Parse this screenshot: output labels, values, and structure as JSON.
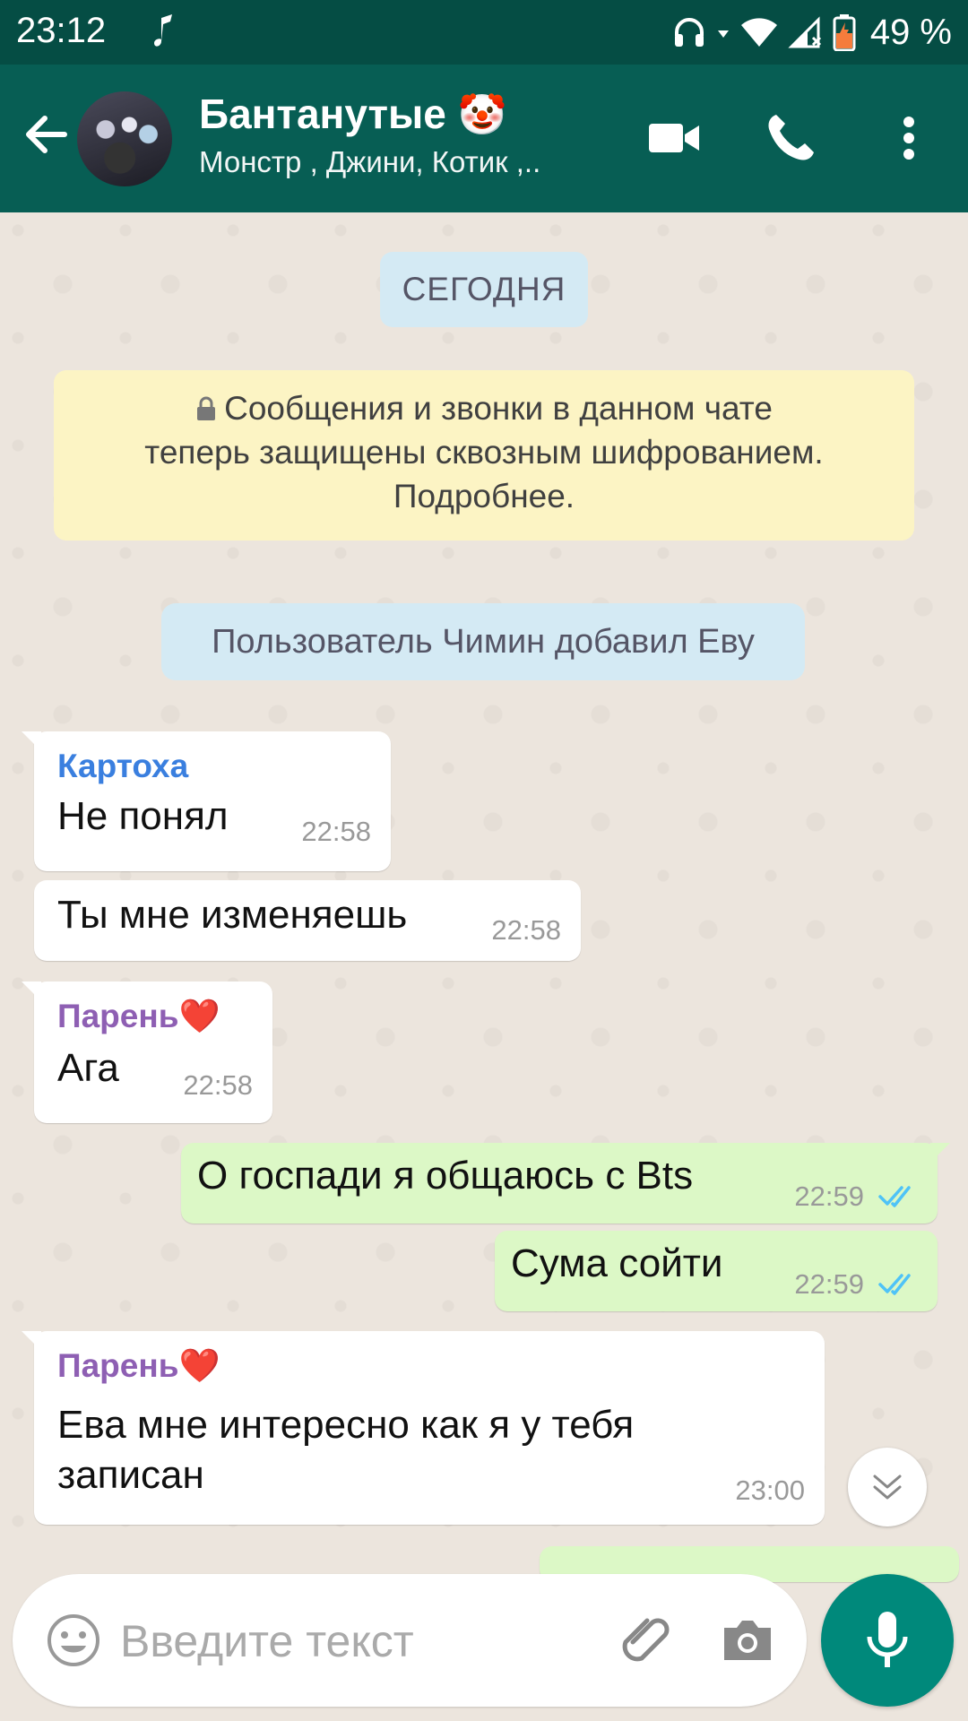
{
  "status_bar": {
    "time": "23:12",
    "battery": "49 %"
  },
  "header": {
    "title": "Бантанутые",
    "title_emoji": "🤡",
    "subtitle": "Монстр , Джини, Котик ,.."
  },
  "chat": {
    "date_label": "СЕГОДНЯ",
    "encryption_notice": {
      "line1": "Сообщения и звонки в данном чате",
      "line2": "теперь защищены сквозным шифрованием.",
      "line3": "Подробнее."
    },
    "system_message": "Пользователь Чимин добавил Еву",
    "messages": [
      {
        "sender": "Картоха",
        "sender_color": "#3a7fdf",
        "text": "Не понял",
        "time": "22:58"
      },
      {
        "text": "Ты мне изменяешь",
        "time": "22:58"
      },
      {
        "sender": "Парень❤️",
        "sender_color": "#8e5fb3",
        "text": "Ага",
        "time": "22:58"
      },
      {
        "text": "О госпади я общаюсь с Bts",
        "time": "22:59"
      },
      {
        "text": "Сума сойти",
        "time": "22:59"
      },
      {
        "sender": "Парень❤️",
        "sender_color": "#8e5fb3",
        "text_line1": "Ева мне интересно как я у тебя",
        "text_line2": "записан",
        "time": "23:00"
      }
    ]
  },
  "input": {
    "placeholder": "Введите текст"
  },
  "icons": {
    "back": "arrow-left-icon",
    "video": "video-camera-icon",
    "call": "phone-icon",
    "more": "more-vert-icon",
    "emoji": "emoji-icon",
    "attach": "paperclip-icon",
    "camera": "camera-icon",
    "mic": "mic-icon",
    "scroll": "chevron-double-down-icon"
  },
  "colors": {
    "header_bg": "#075e54",
    "outgoing_bubble": "#dcf8c6",
    "mic_button": "#00897b",
    "tick_blue": "#4fc3f7"
  }
}
